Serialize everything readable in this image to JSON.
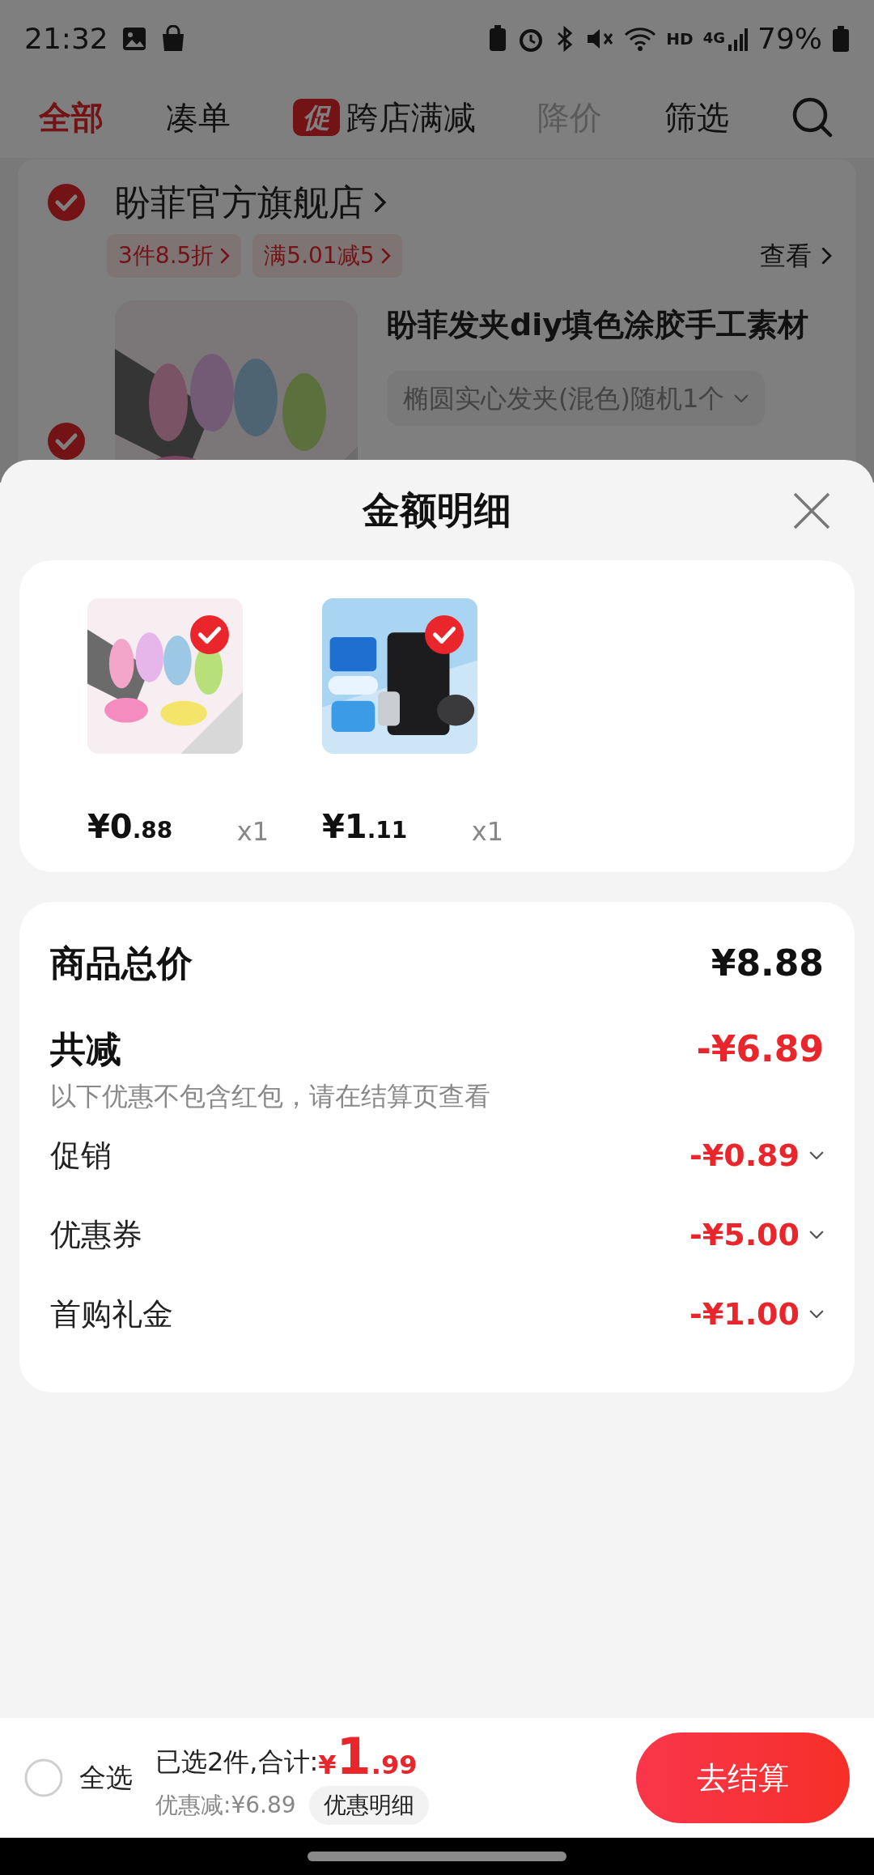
{
  "status_bar": {
    "time": "21:32",
    "hd": "HD",
    "network": "4G",
    "battery": "79%"
  },
  "tabs": [
    {
      "label": "全部",
      "selected": true,
      "disabled": false
    },
    {
      "label": "凑单",
      "selected": false,
      "disabled": false
    },
    {
      "label": "跨店满减",
      "selected": false,
      "disabled": false,
      "badge": "促"
    },
    {
      "label": "降价",
      "selected": false,
      "disabled": true
    },
    {
      "label": "筛选",
      "selected": false,
      "disabled": false
    }
  ],
  "store": {
    "checked": true,
    "name": "盼菲官方旗舰店",
    "promos": [
      "3件8.5折",
      "满5.01减5"
    ],
    "view": "查看"
  },
  "product": {
    "checked": true,
    "title": "盼菲发夹diy填色涂胶手工素材",
    "variant": "椭圆实心发夹(混色)随机1个"
  },
  "sheet": {
    "title": "金额明细",
    "items": [
      {
        "checked": true,
        "price_int": "¥0",
        "price_dec": ".88",
        "qty": "x1"
      },
      {
        "checked": true,
        "price_int": "¥1",
        "price_dec": ".11",
        "qty": "x1"
      }
    ],
    "summary": {
      "total_label": "商品总价",
      "total": "¥8.88",
      "discount_label": "共减",
      "discount": "-¥6.89",
      "note": "以下优惠不包含红包，请在结算页查看",
      "rows": [
        {
          "label": "促销",
          "value": "-¥0.89"
        },
        {
          "label": "优惠券",
          "value": "-¥5.00"
        },
        {
          "label": "首购礼金",
          "value": "-¥1.00"
        }
      ]
    }
  },
  "bottom_bar": {
    "select_all": {
      "label": "全选",
      "checked": false
    },
    "selected_text": "已选2件,合计:",
    "currency": "¥",
    "total_int": "1",
    "total_dec": ".99",
    "discount_text": "优惠减:¥6.89",
    "detail_button": "优惠明细",
    "checkout": "去结算"
  }
}
